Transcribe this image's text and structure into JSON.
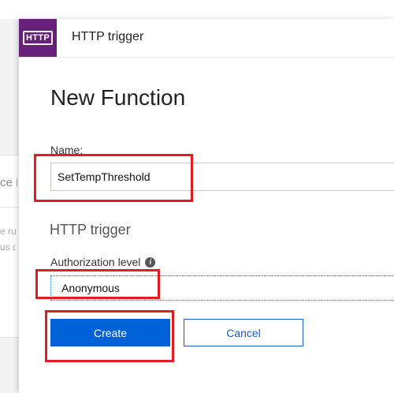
{
  "background": {
    "fragment_heading": "ce B",
    "fragment_line_1": "e rur",
    "fragment_line_2": "us q"
  },
  "blade": {
    "header_icon_text": "HTTP",
    "header_title": "HTTP trigger",
    "page_title": "New Function",
    "name_label": "Name:",
    "name_value": "SetTempThreshold",
    "section_heading": "HTTP trigger",
    "auth_label": "Authorization level",
    "auth_info_glyph": "i",
    "auth_value": "Anonymous",
    "create_label": "Create",
    "cancel_label": "Cancel"
  },
  "colors": {
    "icon_bg": "#68217a",
    "primary_button": "#0062d6",
    "annotation_red": "#e01d25"
  }
}
